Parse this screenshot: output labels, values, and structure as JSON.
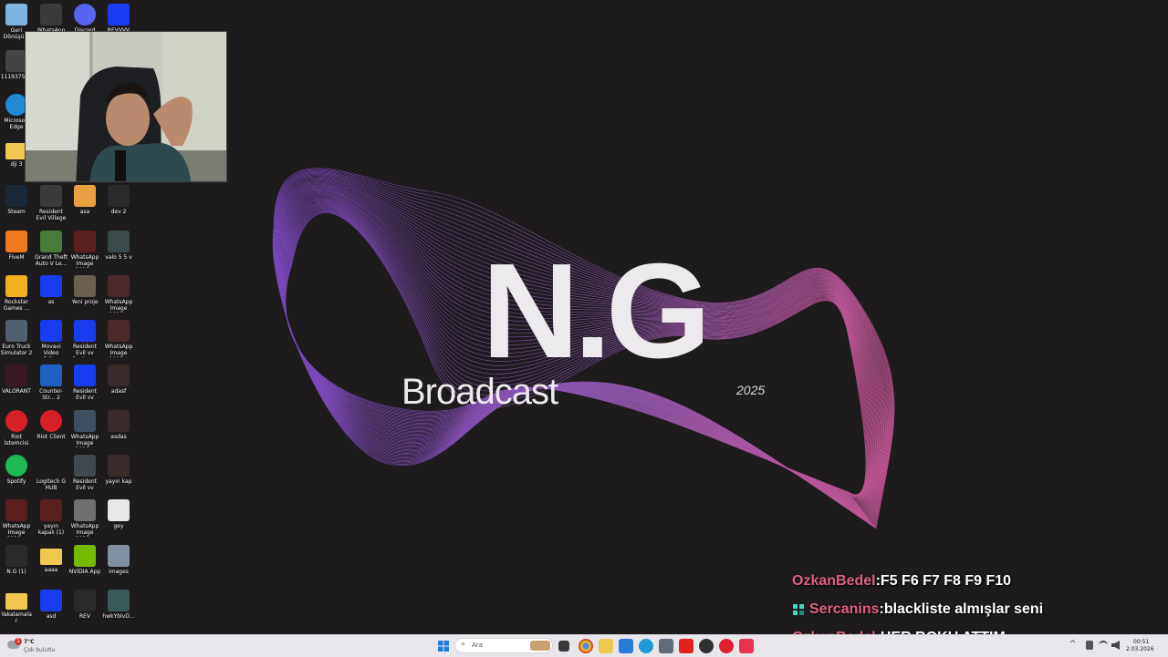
{
  "wallpaper": {
    "brand_title": "N.G",
    "brand_subtitle": "Broadcast",
    "brand_year": "2025",
    "colors": {
      "purple": "#8a4fd8",
      "pink": "#e060a8",
      "text": "#eceaec",
      "background": "#1d1b1c"
    }
  },
  "desktop_icons": [
    {
      "label": "Geri Dönüşüm",
      "icon": "recycle-bin-icon",
      "color": "#7fb4e0"
    },
    {
      "label": "WhatsApp",
      "icon": "image-thumbnail-icon",
      "color": "#3a3a3a"
    },
    {
      "label": "Discord",
      "icon": "discord-icon",
      "color": "#5865f2"
    },
    {
      "label": "REVVVV",
      "icon": "blue-app-icon",
      "color": "#1a3cf0"
    },
    {
      "label": "1119375-...",
      "icon": "image-thumbnail-icon",
      "color": "#444444"
    },
    {
      "label": "Microsoft Edge",
      "icon": "edge-icon",
      "color": "#1f8ad6"
    },
    {
      "label": "dji 3",
      "icon": "folder-icon",
      "color": "#f0c850"
    },
    {
      "label": "Steam",
      "icon": "steam-icon",
      "color": "#1b2838"
    },
    {
      "label": "Resident Evil Village",
      "icon": "game-icon",
      "color": "#3a3a3a"
    },
    {
      "label": "asa",
      "icon": "image-thumbnail-icon",
      "color": "#e8a040"
    },
    {
      "label": "dev 2",
      "icon": "video-thumbnail-icon",
      "color": "#2a2a2a"
    },
    {
      "label": "FiveM",
      "icon": "fivem-icon",
      "color": "#f07a20"
    },
    {
      "label": "Grand Theft Auto V Le...",
      "icon": "gta-icon",
      "color": "#4a7a3a"
    },
    {
      "label": "WhatsApp Image 2026...",
      "icon": "image-thumbnail-icon",
      "color": "#5a2020"
    },
    {
      "label": "valo 5 5 v",
      "icon": "video-thumbnail-icon",
      "color": "#3a4a4a"
    },
    {
      "label": "Rockstar Games ...",
      "icon": "rockstar-icon",
      "color": "#f0b020"
    },
    {
      "label": "as",
      "icon": "blue-app-icon",
      "color": "#1a3cf0"
    },
    {
      "label": "Yeni proje",
      "icon": "image-thumbnail-icon",
      "color": "#6a6050"
    },
    {
      "label": "WhatsApp Image 2026...",
      "icon": "image-thumbnail-icon",
      "color": "#4a2a2a"
    },
    {
      "label": "Euro Truck Simulator 2",
      "icon": "truck-icon",
      "color": "#506070"
    },
    {
      "label": "Movavi Video Edit...",
      "icon": "blue-app-icon",
      "color": "#1a3cf0"
    },
    {
      "label": "Resident Evil vv Backup...",
      "icon": "blue-app-icon",
      "color": "#1a3cf0"
    },
    {
      "label": "WhatsApp Image 2026...",
      "icon": "image-thumbnail-icon",
      "color": "#4a2a2a"
    },
    {
      "label": "VALORANT",
      "icon": "valorant-icon",
      "color": "#3a1a22"
    },
    {
      "label": "Counter-Str... 2",
      "icon": "cs2-icon",
      "color": "#2060c0"
    },
    {
      "label": "Resident Evil vv",
      "icon": "blue-app-icon",
      "color": "#1a3cf0"
    },
    {
      "label": "adasf",
      "icon": "image-thumbnail-icon",
      "color": "#3a2a2a"
    },
    {
      "label": "Riot İstemcisi",
      "icon": "riot-icon",
      "color": "#d8202a"
    },
    {
      "label": "Riot Client",
      "icon": "riot-icon",
      "color": "#d8202a"
    },
    {
      "label": "WhatsApp Image 2026...",
      "icon": "image-thumbnail-icon",
      "color": "#405060"
    },
    {
      "label": "asdas",
      "icon": "image-thumbnail-icon",
      "color": "#3a2a2a"
    },
    {
      "label": "Spotify",
      "icon": "spotify-icon",
      "color": "#1db954"
    },
    {
      "label": "Logitech G HUB",
      "icon": "logitech-icon",
      "color": "#1d1b1c"
    },
    {
      "label": "Resident Evil vv",
      "icon": "video-thumbnail-icon",
      "color": "#404850"
    },
    {
      "label": "yayın kap",
      "icon": "image-thumbnail-icon",
      "color": "#3a2a2a"
    },
    {
      "label": "WhatsApp Image 2026...",
      "icon": "image-thumbnail-icon",
      "color": "#5a2020"
    },
    {
      "label": "yayın kapalı (1)",
      "icon": "image-thumbnail-icon",
      "color": "#5a2020"
    },
    {
      "label": "WhatsApp Image 2026...",
      "icon": "image-thumbnail-icon",
      "color": "#707070"
    },
    {
      "label": "gey",
      "icon": "media-file-icon",
      "color": "#e8e8e8"
    },
    {
      "label": "N.G (1)",
      "icon": "image-thumbnail-icon",
      "color": "#2a2a2a"
    },
    {
      "label": "aaaa",
      "icon": "folder-icon",
      "color": "#f0c850"
    },
    {
      "label": "NVIDIA App",
      "icon": "nvidia-icon",
      "color": "#76b900"
    },
    {
      "label": "images",
      "icon": "image-thumbnail-icon",
      "color": "#8090a0"
    },
    {
      "label": "Yakalamalar",
      "icon": "folder-icon",
      "color": "#f0c850"
    },
    {
      "label": "asd",
      "icon": "blue-app-icon",
      "color": "#1a3cf0"
    },
    {
      "label": "REV",
      "icon": "video-thumbnail-icon",
      "color": "#2a2a2a"
    },
    {
      "label": "hwkYblvD...",
      "icon": "image-thumbnail-icon",
      "color": "#3a5a5a"
    }
  ],
  "chat": {
    "messages": [
      {
        "user": "OzkanBedel",
        "sep": " : ",
        "text": "F5 F6 F7 F8 F9 F10",
        "badge": false
      },
      {
        "user": "Sercanins",
        "sep": " : ",
        "text": "blackliste almışlar seni",
        "badge": true
      },
      {
        "user": "OzkanBedel",
        "sep": " : ",
        "text": "HER BOKU ATTIM",
        "badge": false
      }
    ]
  },
  "taskbar": {
    "weather_temp": "7°C",
    "weather_desc": "Çok bulutlu",
    "notification_count": "1",
    "search_placeholder": "Ara",
    "time": "00:51",
    "date": "2.03.2026"
  }
}
